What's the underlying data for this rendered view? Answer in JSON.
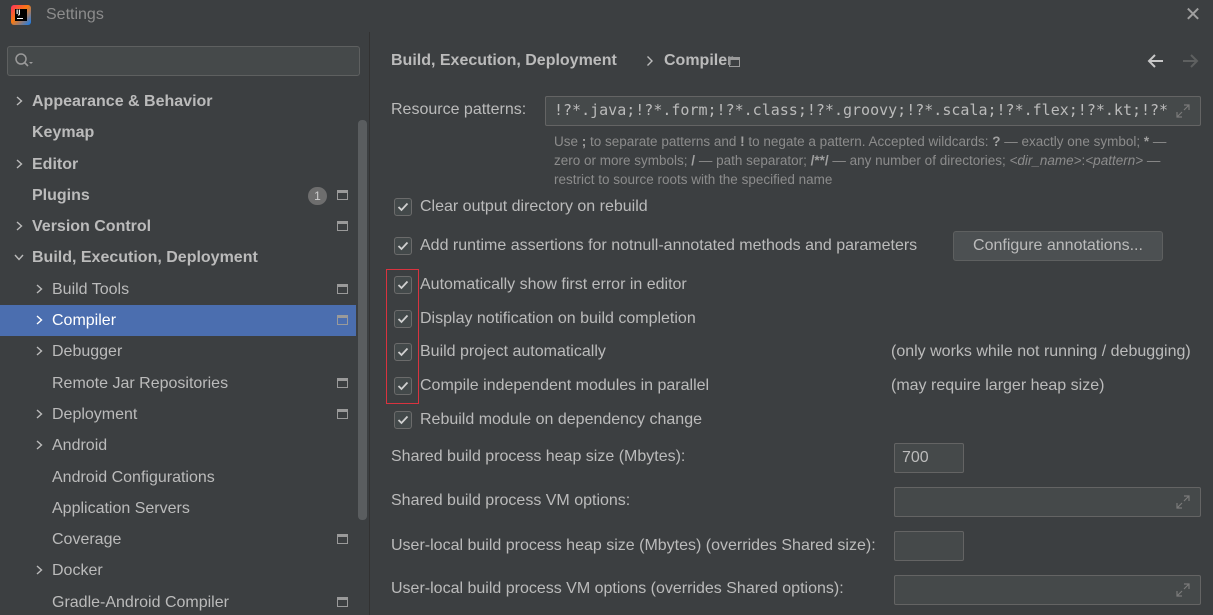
{
  "window": {
    "title": "Settings"
  },
  "search": {
    "placeholder": "",
    "value": ""
  },
  "sidebar": {
    "items": [
      {
        "label": "Appearance & Behavior",
        "level": 0,
        "bold": true,
        "expandable": true,
        "expanded": false,
        "project": false
      },
      {
        "label": "Keymap",
        "level": 0,
        "bold": true,
        "expandable": false,
        "project": false
      },
      {
        "label": "Editor",
        "level": 0,
        "bold": true,
        "expandable": true,
        "expanded": false,
        "project": false
      },
      {
        "label": "Plugins",
        "level": 0,
        "bold": true,
        "expandable": false,
        "project": true,
        "badge": "1"
      },
      {
        "label": "Version Control",
        "level": 0,
        "bold": true,
        "expandable": true,
        "expanded": false,
        "project": true
      },
      {
        "label": "Build, Execution, Deployment",
        "level": 0,
        "bold": true,
        "expandable": true,
        "expanded": true,
        "project": false
      },
      {
        "label": "Build Tools",
        "level": 1,
        "bold": false,
        "expandable": true,
        "expanded": false,
        "project": true
      },
      {
        "label": "Compiler",
        "level": 1,
        "bold": false,
        "expandable": true,
        "expanded": false,
        "project": true,
        "selected": true
      },
      {
        "label": "Debugger",
        "level": 1,
        "bold": false,
        "expandable": true,
        "expanded": false,
        "project": false
      },
      {
        "label": "Remote Jar Repositories",
        "level": 1,
        "bold": false,
        "expandable": false,
        "project": true
      },
      {
        "label": "Deployment",
        "level": 1,
        "bold": false,
        "expandable": true,
        "expanded": false,
        "project": true
      },
      {
        "label": "Android",
        "level": 1,
        "bold": false,
        "expandable": true,
        "expanded": false,
        "project": false
      },
      {
        "label": "Android Configurations",
        "level": 1,
        "bold": false,
        "expandable": false,
        "project": false
      },
      {
        "label": "Application Servers",
        "level": 1,
        "bold": false,
        "expandable": false,
        "project": false
      },
      {
        "label": "Coverage",
        "level": 1,
        "bold": false,
        "expandable": false,
        "project": true
      },
      {
        "label": "Docker",
        "level": 1,
        "bold": false,
        "expandable": true,
        "expanded": false,
        "project": false
      },
      {
        "label": "Gradle-Android Compiler",
        "level": 1,
        "bold": false,
        "expandable": false,
        "project": true
      }
    ]
  },
  "breadcrumb": {
    "parent": "Build, Execution, Deployment",
    "current": "Compiler"
  },
  "resource_patterns": {
    "label": "Resource patterns:",
    "value": "!?*.java;!?*.form;!?*.class;!?*.groovy;!?*.scala;!?*.flex;!?*.kt;!?*",
    "hint_1a": "Use ",
    "hint_1b": ";",
    "hint_1c": " to separate patterns and ",
    "hint_1d": "!",
    "hint_1e": " to negate a pattern. Accepted wildcards: ",
    "hint_1f": "?",
    "hint_1g": " — exactly one symbol; ",
    "hint_1h": "*",
    "hint_1i": " —",
    "hint_2a": "zero or more symbols; ",
    "hint_2b": "/",
    "hint_2c": " — path separator; ",
    "hint_2d": "/**/",
    "hint_2e": " — any number of directories; ",
    "hint_2f": "<dir_name>",
    "hint_2g": ":",
    "hint_2h": "<pattern>",
    "hint_2i": " —",
    "hint_3": "restrict to source roots with the specified name"
  },
  "options": {
    "clear_output": {
      "label": "Clear output directory on rebuild",
      "checked": true
    },
    "runtime_assertions": {
      "label": "Add runtime assertions for notnull-annotated methods and parameters",
      "checked": true
    },
    "configure_annotations": "Configure annotations...",
    "show_first_error": {
      "label": "Automatically show first error in editor",
      "checked": true
    },
    "display_notification": {
      "label": "Display notification on build completion",
      "checked": true
    },
    "build_auto": {
      "label": "Build project automatically",
      "checked": true,
      "note": "(only works while not running / debugging)"
    },
    "compile_parallel": {
      "label": "Compile independent modules in parallel",
      "checked": true,
      "note": "(may require larger heap size)"
    },
    "rebuild_dependency": {
      "label": "Rebuild module on dependency change",
      "checked": true
    }
  },
  "heap": {
    "shared_heap_label": "Shared build process heap size (Mbytes):",
    "shared_heap_value": "700",
    "shared_vm_label": "Shared build process VM options:",
    "shared_vm_value": "",
    "user_heap_label": "User-local build process heap size (Mbytes) (overrides Shared size):",
    "user_heap_value": "",
    "user_vm_label": "User-local build process VM options (overrides Shared options):",
    "user_vm_value": ""
  },
  "colors": {
    "selection": "#4b6eaf",
    "highlight_border": "#d9333f",
    "background": "#3c3f41"
  }
}
